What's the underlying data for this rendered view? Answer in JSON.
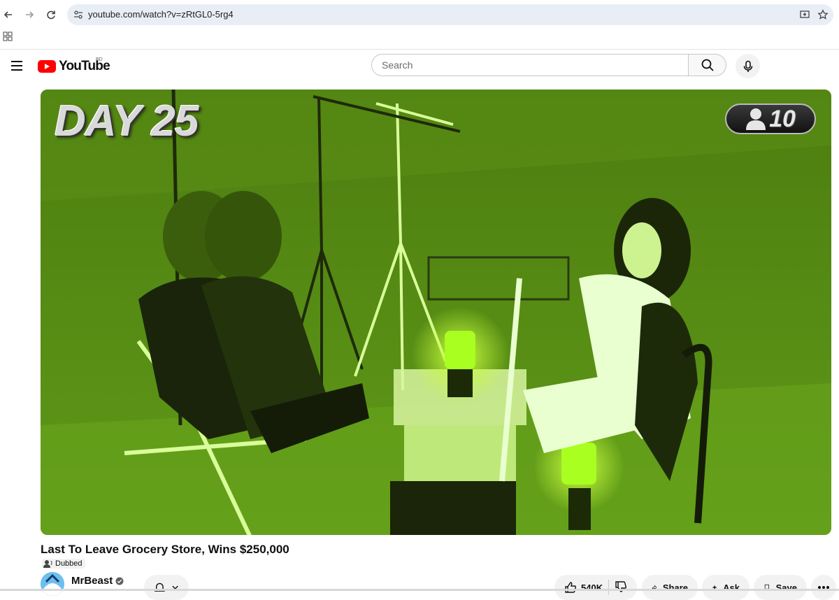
{
  "browser": {
    "url": "youtube.com/watch?v=zRtGL0-5rg4"
  },
  "masthead": {
    "logo_text": "YouTube",
    "country_code": "BD",
    "search_placeholder": "Search"
  },
  "player": {
    "overlay_day": "DAY 25",
    "remaining_count": "10"
  },
  "video": {
    "title": "Last To Leave Grocery Store, Wins $250,000",
    "dubbed_label": "Dubbed",
    "channel": "MrBeast"
  },
  "actions": {
    "likes": "540K",
    "share_label": "Share",
    "ask_label": "Ask",
    "save_label": "Save"
  },
  "colors": {
    "brand_red": "#ff0000",
    "nightvision_green": "#5a8f16"
  }
}
